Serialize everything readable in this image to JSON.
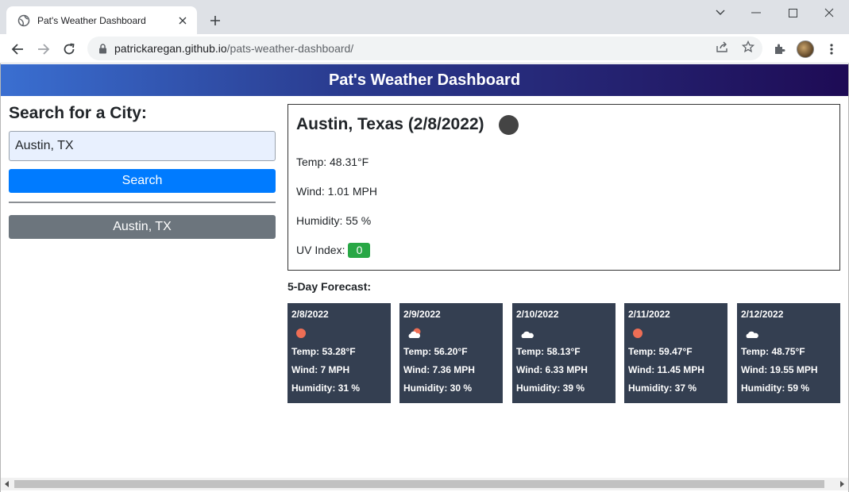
{
  "browser": {
    "tab_title": "Pat's Weather Dashboard",
    "url_host": "patrickaregan.github.io",
    "url_path": "/pats-weather-dashboard/"
  },
  "header": {
    "title": "Pat's Weather Dashboard"
  },
  "search": {
    "heading": "Search for a City:",
    "input_value": "Austin, TX",
    "button_label": "Search",
    "history": [
      "Austin, TX"
    ]
  },
  "current": {
    "title": "Austin, Texas (2/8/2022)",
    "temp": "Temp: 48.31°F",
    "wind": "Wind: 1.01 MPH",
    "humidity": "Humidity: 55 %",
    "uv_label": "UV Index:",
    "uv_value": "0",
    "uv_color": "#28a745"
  },
  "forecast": {
    "title": "5-Day Forecast:",
    "days": [
      {
        "date": "2/8/2022",
        "icon": "sun-icon",
        "temp": "Temp: 53.28°F",
        "wind": "Wind: 7 MPH",
        "humidity": "Humidity: 31 %"
      },
      {
        "date": "2/9/2022",
        "icon": "partly-cloudy-icon",
        "temp": "Temp: 56.20°F",
        "wind": "Wind: 7.36 MPH",
        "humidity": "Humidity: 30 %"
      },
      {
        "date": "2/10/2022",
        "icon": "cloud-icon",
        "temp": "Temp: 58.13°F",
        "wind": "Wind: 6.33 MPH",
        "humidity": "Humidity: 39 %"
      },
      {
        "date": "2/11/2022",
        "icon": "sun-icon",
        "temp": "Temp: 59.47°F",
        "wind": "Wind: 11.45 MPH",
        "humidity": "Humidity: 37 %"
      },
      {
        "date": "2/12/2022",
        "icon": "cloud-icon",
        "temp": "Temp: 48.75°F",
        "wind": "Wind: 19.55 MPH",
        "humidity": "Humidity: 59 %"
      }
    ]
  },
  "colors": {
    "search_button": "#007bff",
    "history_button": "#6c757d",
    "forecast_card": "#343f51",
    "sun": "#ee6e55"
  }
}
